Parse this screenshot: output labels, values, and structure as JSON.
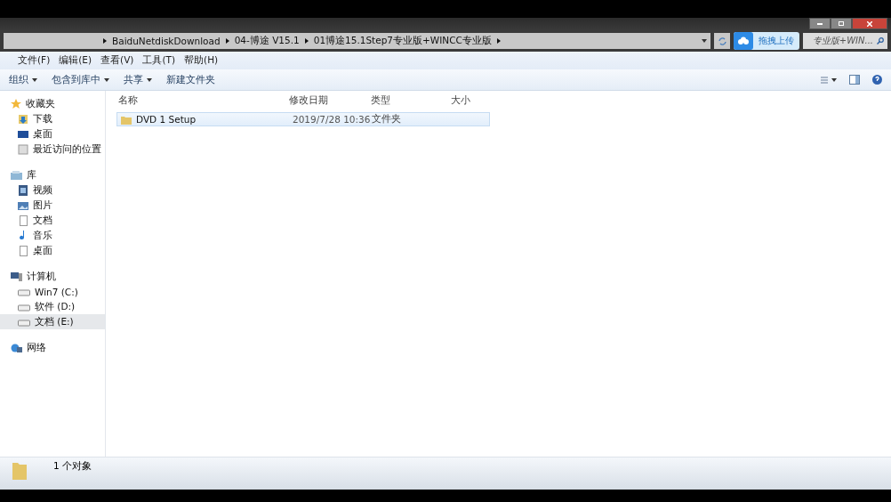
{
  "address_bar": {
    "crumbs": [
      "BaiduNetdiskDownload",
      "04-博途 V15.1",
      "01博途15.1Step7专业版+WINCC专业版"
    ]
  },
  "search": {
    "placeholder": "专业版+WIN..."
  },
  "upload_popup": {
    "label": "拖拽上传"
  },
  "menu": [
    "文件(F)",
    "编辑(E)",
    "查看(V)",
    "工具(T)",
    "帮助(H)"
  ],
  "toolbar": [
    {
      "label": "组织",
      "dropdown": true
    },
    {
      "label": "包含到库中",
      "dropdown": true
    },
    {
      "label": "共享",
      "dropdown": true
    },
    {
      "label": "新建文件夹",
      "dropdown": false
    }
  ],
  "sidebar": {
    "groups": [
      {
        "label": "收藏夹",
        "children": [
          {
            "label": "下载",
            "selected": false
          },
          {
            "label": "桌面",
            "selected": false
          },
          {
            "label": "最近访问的位置",
            "selected": false
          }
        ]
      },
      {
        "label": "库",
        "children": [
          {
            "label": "视频",
            "selected": false
          },
          {
            "label": "图片",
            "selected": false
          },
          {
            "label": "文档",
            "selected": false
          },
          {
            "label": "音乐",
            "selected": false
          },
          {
            "label": "桌面",
            "selected": false
          }
        ]
      },
      {
        "label": "计算机",
        "children": [
          {
            "label": "Win7 (C:)",
            "selected": false
          },
          {
            "label": "软件 (D:)",
            "selected": false
          },
          {
            "label": "文档 (E:)",
            "selected": true
          }
        ]
      },
      {
        "label": "网络"
      }
    ]
  },
  "table": {
    "columns": [
      "名称",
      "修改日期",
      "类型",
      "大小"
    ],
    "rows": [
      {
        "name": "DVD 1 Setup",
        "modified": "2019/7/28 10:36",
        "type": "文件夹",
        "selected": true
      }
    ]
  },
  "status_bar": {
    "text": "1 个对象"
  }
}
